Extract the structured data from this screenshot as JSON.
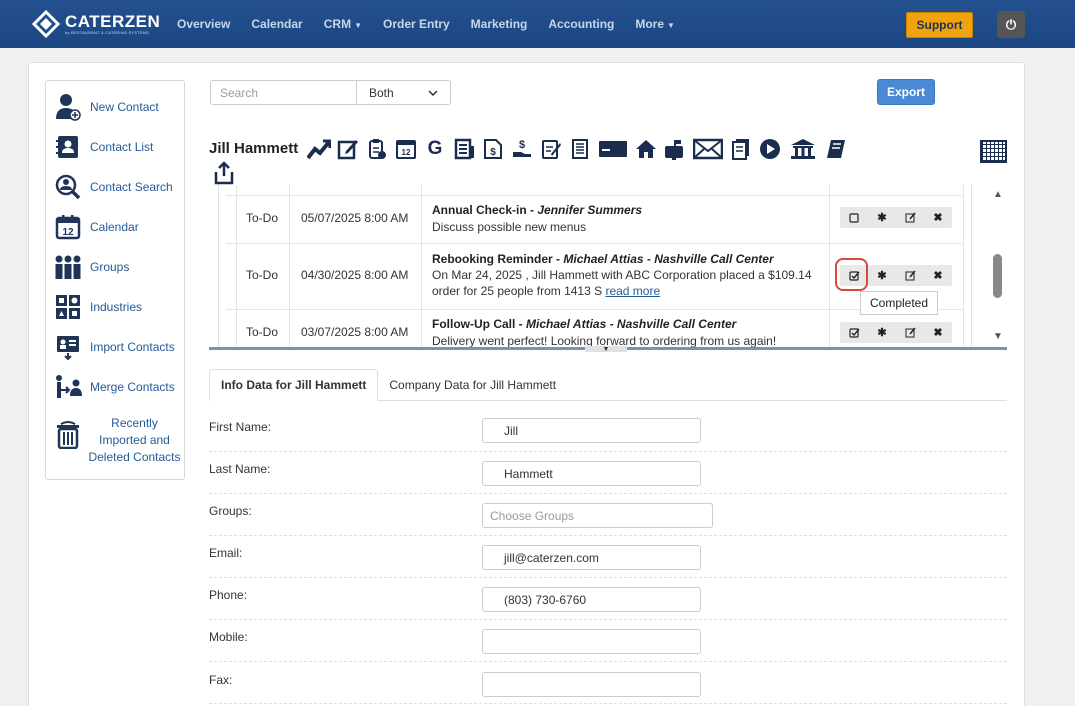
{
  "brand": {
    "name": "CATERZEN",
    "tagline": "by RESTAURANT & CATERING SYSTEMS"
  },
  "nav": {
    "items": [
      {
        "label": "Overview",
        "dropdown": false
      },
      {
        "label": "Calendar",
        "dropdown": false
      },
      {
        "label": "CRM",
        "dropdown": true
      },
      {
        "label": "Order Entry",
        "dropdown": false
      },
      {
        "label": "Marketing",
        "dropdown": false
      },
      {
        "label": "Accounting",
        "dropdown": false
      },
      {
        "label": "More",
        "dropdown": true
      }
    ],
    "support_label": "Support",
    "power_icon": "power-icon"
  },
  "sidebar": {
    "items": [
      {
        "label": "New Contact",
        "icon": "add-user-icon"
      },
      {
        "label": "Contact List",
        "icon": "contact-book-icon"
      },
      {
        "label": "Contact Search",
        "icon": "search-user-icon"
      },
      {
        "label": "Calendar",
        "icon": "calendar-icon"
      },
      {
        "label": "Groups",
        "icon": "group-icon"
      },
      {
        "label": "Industries",
        "icon": "industries-icon"
      },
      {
        "label": "Import Contacts",
        "icon": "import-icon"
      },
      {
        "label": "Merge Contacts",
        "icon": "merge-icon"
      },
      {
        "label": "Recently Imported and Deleted Contacts",
        "icon": "trash-icon"
      }
    ]
  },
  "search": {
    "placeholder": "Search",
    "scope_value": "Both",
    "export_label": "Export"
  },
  "contact": {
    "name": "Jill Hammett"
  },
  "activities": [
    {
      "type": "To-Do",
      "date": "05/07/2025 8:00 AM",
      "title": "Annual Check-in",
      "title_people": "Jennifer Summers",
      "description": "Discuss possible new menus",
      "done": false
    },
    {
      "type": "To-Do",
      "date": "04/30/2025 8:00 AM",
      "title": "Rebooking Reminder",
      "title_people": "Michael Attias - Nashville Call Center",
      "description": "On Mar 24, 2025 , Jill Hammett with ABC Corporation placed a $109.14 order for 25 people from 1413 S",
      "read_more": "read more",
      "done": true
    },
    {
      "type": "To-Do",
      "date": "03/07/2025 8:00 AM",
      "title": "Follow-Up Call",
      "title_people": "Michael Attias - Nashville Call Center",
      "description": "Delivery went perfect! Looking forward to ordering from us again!",
      "done": true
    }
  ],
  "tooltip": {
    "text": "Completed"
  },
  "tabs": [
    {
      "label": "Info Data for Jill Hammett",
      "active": true
    },
    {
      "label": "Company Data for Jill Hammett",
      "active": false
    }
  ],
  "form": {
    "fields": [
      {
        "label": "First Name:",
        "value": "Jill",
        "placeholder": ""
      },
      {
        "label": "Last Name:",
        "value": "Hammett",
        "placeholder": ""
      },
      {
        "label": "Groups:",
        "value": "",
        "placeholder": "Choose Groups"
      },
      {
        "label": "Email:",
        "value": "jill@caterzen.com",
        "placeholder": ""
      },
      {
        "label": "Phone:",
        "value": "(803) 730-6760",
        "placeholder": ""
      },
      {
        "label": "Mobile:",
        "value": "",
        "placeholder": ""
      },
      {
        "label": "Fax:",
        "value": "",
        "placeholder": ""
      }
    ]
  },
  "colors": {
    "nav_bg": "#1f4e8c",
    "support": "#f0a30a",
    "export": "#4a8ad4",
    "highlight": "#d9473f",
    "link": "#245b97"
  }
}
